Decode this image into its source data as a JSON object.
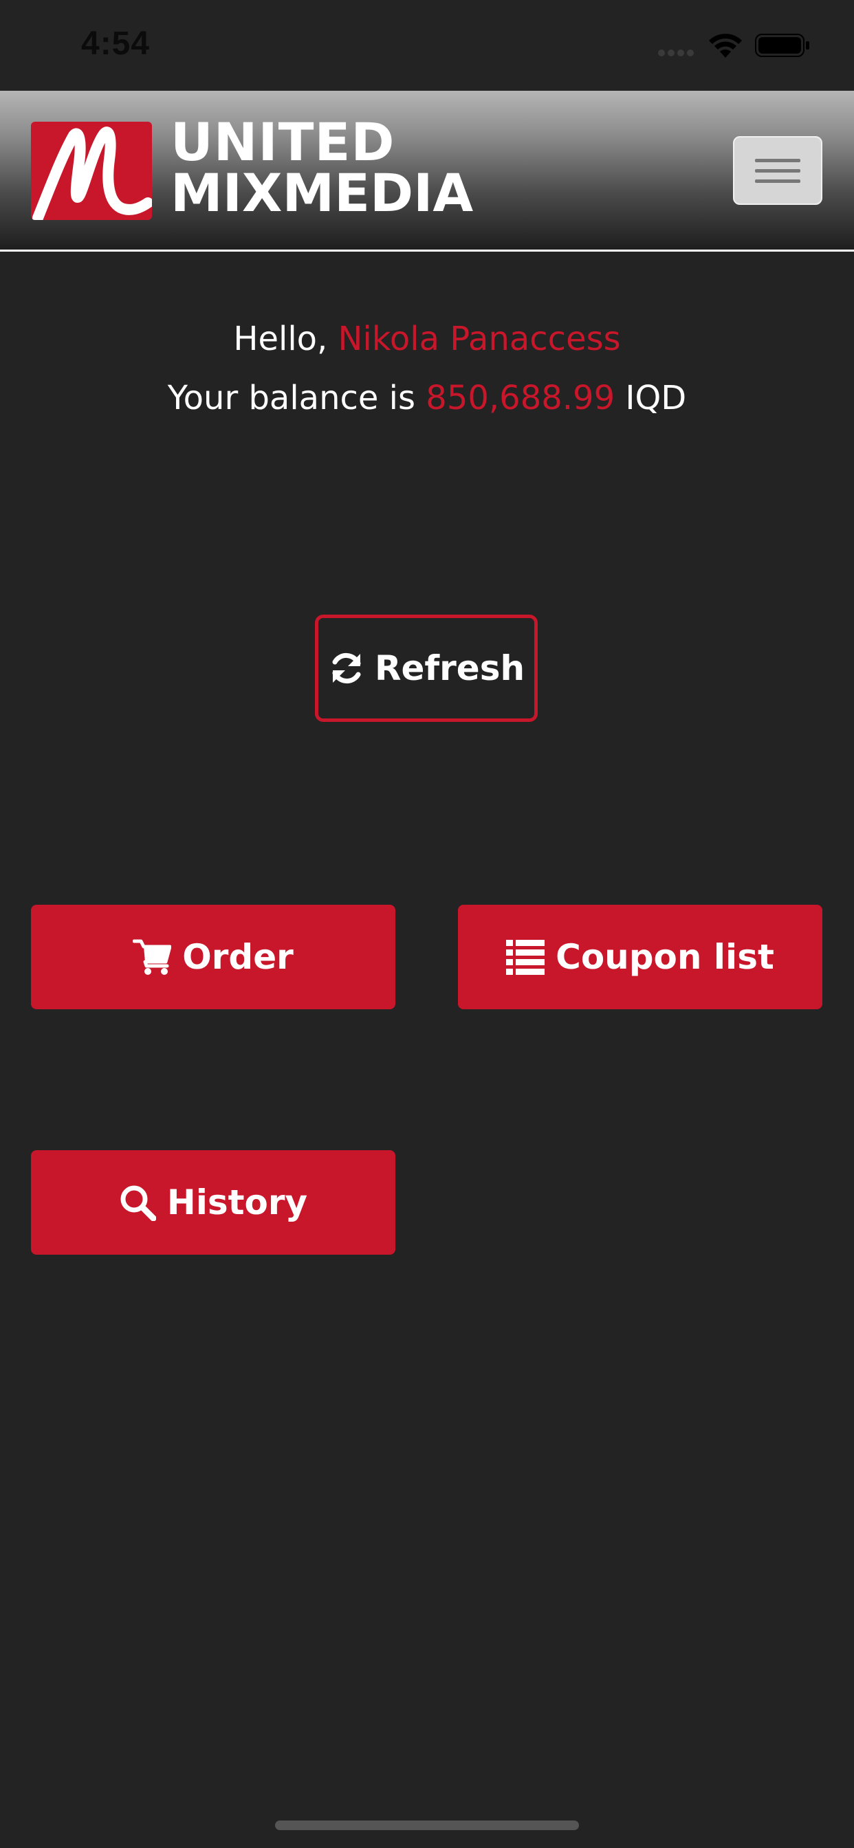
{
  "status_bar": {
    "time": "4:54"
  },
  "header": {
    "logo_line1": "UNITED",
    "logo_line2": "MIXMEDIA",
    "menu_icon": "hamburger-icon"
  },
  "greeting": {
    "hello_prefix": "Hello, ",
    "user_name": "Nikola Panaccess",
    "balance_prefix": "Your balance is ",
    "balance_amount": "850,688.99",
    "currency": " IQD"
  },
  "actions": {
    "refresh_label": "Refresh",
    "order_label": "Order",
    "coupon_list_label": "Coupon list",
    "history_label": "History"
  },
  "colors": {
    "accent": "#c8162a",
    "background": "#232323"
  }
}
